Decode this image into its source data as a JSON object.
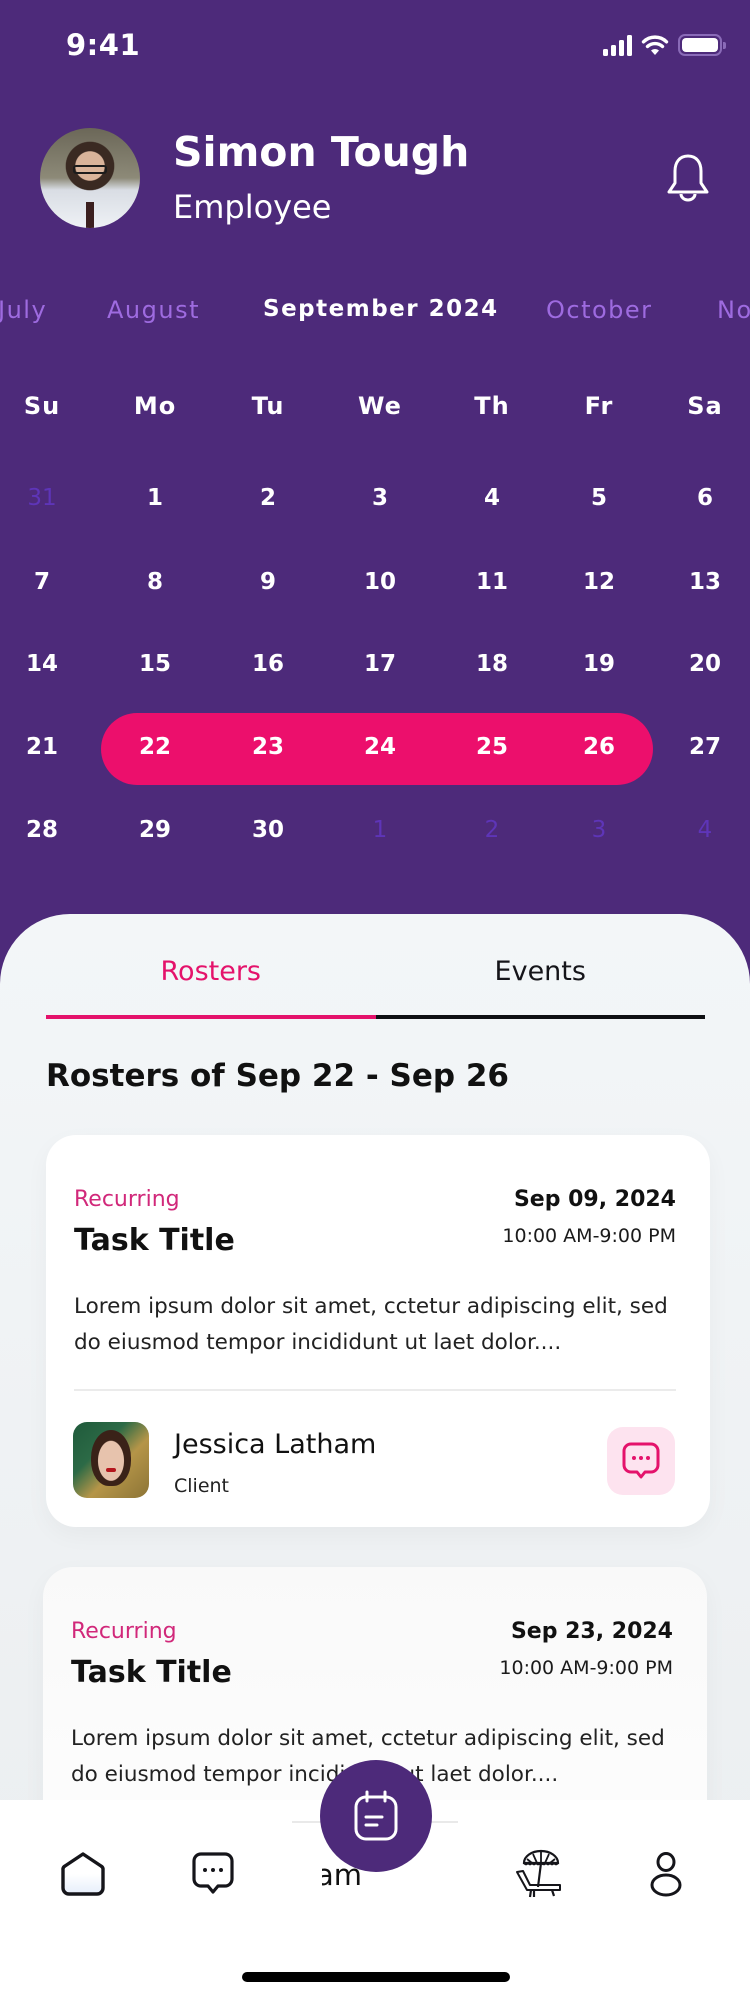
{
  "status_bar": {
    "time": "9:41"
  },
  "profile": {
    "name": "Simon Tough",
    "role": "Employee"
  },
  "calendar": {
    "months": [
      {
        "label": "July",
        "current": false
      },
      {
        "label": "August",
        "current": false
      },
      {
        "label": "September 2024",
        "current": true
      },
      {
        "label": "October",
        "current": false
      },
      {
        "label": "November",
        "current": false
      }
    ],
    "weekdays": [
      "Su",
      "Mo",
      "Tu",
      "We",
      "Th",
      "Fr",
      "Sa"
    ],
    "weeks": [
      [
        {
          "d": "31",
          "muted": true
        },
        {
          "d": "1"
        },
        {
          "d": "2"
        },
        {
          "d": "3"
        },
        {
          "d": "4"
        },
        {
          "d": "5"
        },
        {
          "d": "6"
        }
      ],
      [
        {
          "d": "7"
        },
        {
          "d": "8"
        },
        {
          "d": "9"
        },
        {
          "d": "10"
        },
        {
          "d": "11"
        },
        {
          "d": "12"
        },
        {
          "d": "13"
        }
      ],
      [
        {
          "d": "14"
        },
        {
          "d": "15"
        },
        {
          "d": "16"
        },
        {
          "d": "17"
        },
        {
          "d": "18"
        },
        {
          "d": "19"
        },
        {
          "d": "20"
        }
      ],
      [
        {
          "d": "21"
        },
        {
          "d": "22",
          "sel": true
        },
        {
          "d": "23",
          "sel": true
        },
        {
          "d": "24",
          "sel": true
        },
        {
          "d": "25",
          "sel": true
        },
        {
          "d": "26",
          "sel": true
        },
        {
          "d": "27"
        }
      ],
      [
        {
          "d": "28"
        },
        {
          "d": "29"
        },
        {
          "d": "30"
        },
        {
          "d": "1",
          "muted": true
        },
        {
          "d": "2",
          "muted": true
        },
        {
          "d": "3",
          "muted": true
        },
        {
          "d": "4",
          "muted": true
        }
      ]
    ],
    "selected_range": "Sep 22 - Sep 26"
  },
  "tabs": [
    {
      "label": "Rosters",
      "active": true
    },
    {
      "label": "Events",
      "active": false
    }
  ],
  "section_title": "Rosters of Sep 22 - Sep 26",
  "rosters": [
    {
      "type": "Recurring",
      "title": "Task Title",
      "date": "Sep 09, 2024",
      "time": "10:00 AM-9:00 PM",
      "description": "Lorem ipsum dolor sit amet, cctetur adipiscing elit, sed do eiusmod tempor incididunt ut laet dolor....",
      "client": {
        "name": "Jessica Latham",
        "role": "Client"
      }
    },
    {
      "type": "Recurring",
      "title": "Task Title",
      "date": "Sep 23, 2024",
      "time": "10:00 AM-9:00 PM",
      "description": "Lorem ipsum dolor sit amet, cctetur adipiscing elit, sed do eiusmod tempor incididunt ut laet dolor...."
    }
  ],
  "bottom_nav": {
    "items": [
      {
        "icon": "home-icon"
      },
      {
        "icon": "chat-icon"
      },
      {
        "icon": "roster-icon",
        "label": "am"
      },
      {
        "icon": "leave-icon"
      },
      {
        "icon": "profile-icon"
      }
    ],
    "fab_icon": "calendar-icon"
  },
  "colors": {
    "primary": "#4D2A7A",
    "accent": "#EC0F6C",
    "muted_month": "#9E6BE0",
    "muted_day": "#5E35B8"
  }
}
